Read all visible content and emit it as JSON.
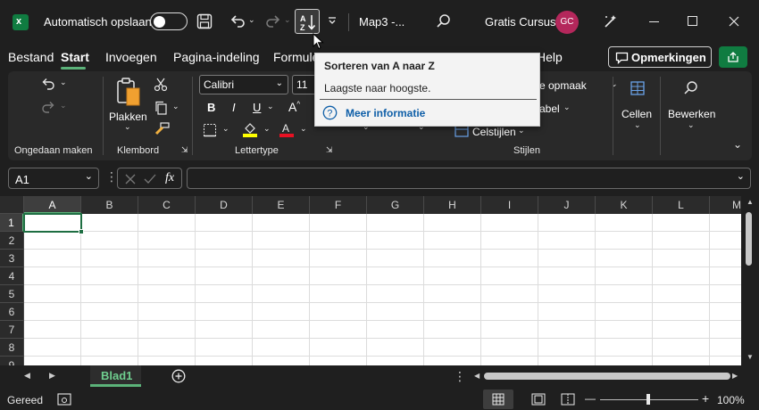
{
  "titlebar": {
    "app_icon": "excel-icon",
    "autosave_label": "Automatisch opslaan",
    "filename": "Map3  -...",
    "account_name": "Gratis Cursus",
    "avatar_initials": "GC"
  },
  "menu": {
    "tabs": [
      "Bestand",
      "Start",
      "Invoegen",
      "Pagina-indeling",
      "Formule",
      "Help"
    ],
    "active_tab": "Start",
    "comments_label": "Opmerkingen"
  },
  "ribbon": {
    "undo_group_label": "Ongedaan maken",
    "paste_label": "Plakken",
    "clipboard_group_label": "Klembord",
    "font_name": "Calibri",
    "font_size": "11",
    "font_group_label": "Lettertype",
    "bold_label": "B",
    "italic_label": "I",
    "underline_label": "U",
    "conditional_format_label": "e opmaak",
    "table_format_label": "abel",
    "cell_styles_label": "Celstijlen",
    "styles_group_label": "Stijlen",
    "cells_label": "Cellen",
    "edit_label": "Bewerken"
  },
  "tooltip": {
    "title": "Sorteren van A naar Z",
    "description": "Laagste naar hoogste.",
    "link": "Meer informatie"
  },
  "formula_bar": {
    "name_box": "A1",
    "fx_label": "fx",
    "value": ""
  },
  "grid": {
    "columns": [
      "A",
      "B",
      "C",
      "D",
      "E",
      "F",
      "G",
      "H",
      "I",
      "J",
      "K",
      "L",
      "M"
    ],
    "rows": [
      "1",
      "2",
      "3",
      "4",
      "5",
      "6",
      "7",
      "8",
      "9"
    ],
    "selected_cell": "A1"
  },
  "sheets": {
    "tabs": [
      "Blad1"
    ],
    "active": "Blad1"
  },
  "status": {
    "ready_label": "Gereed",
    "zoom": "100%",
    "zoom_minus": "—",
    "zoom_plus": "+"
  },
  "colors": {
    "accent_green": "#5bb279",
    "share_green": "#107c41",
    "link_blue": "#0f5fa8"
  }
}
